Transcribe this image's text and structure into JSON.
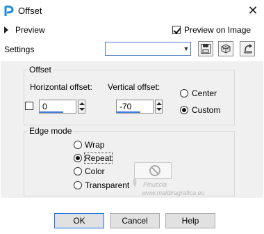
{
  "window": {
    "title": "Offset",
    "close_glyph": "✕"
  },
  "preview": {
    "toggle_label": "Preview",
    "preview_on_image_label": "Preview on Image",
    "preview_on_image_checked": true
  },
  "settings": {
    "label": "Settings",
    "value": "",
    "icons": [
      "save-preset-icon",
      "presets-cube-icon",
      "reset-icon"
    ]
  },
  "offset_group": {
    "label": "Offset",
    "horizontal": {
      "label": "Horizontal offset:",
      "value": "0"
    },
    "vertical": {
      "label": "Vertical offset:",
      "value": "-70"
    },
    "options": [
      {
        "label": "Center",
        "selected": false
      },
      {
        "label": "Custom",
        "selected": true
      }
    ],
    "link_checked": false
  },
  "edge_group": {
    "label": "Edge mode",
    "options": [
      {
        "label": "Wrap",
        "selected": false
      },
      {
        "label": "Repeat",
        "selected": true
      },
      {
        "label": "Color",
        "selected": false
      },
      {
        "label": "Transparent",
        "selected": false
      }
    ]
  },
  "watermark": {
    "name": "Pinuccia",
    "site": "www.maidiragrafica.eu"
  },
  "buttons": {
    "ok": "OK",
    "cancel": "Cancel",
    "help": "Help"
  },
  "colors": {
    "accent": "#3d7ddc",
    "panel": "#f0f0f0"
  }
}
